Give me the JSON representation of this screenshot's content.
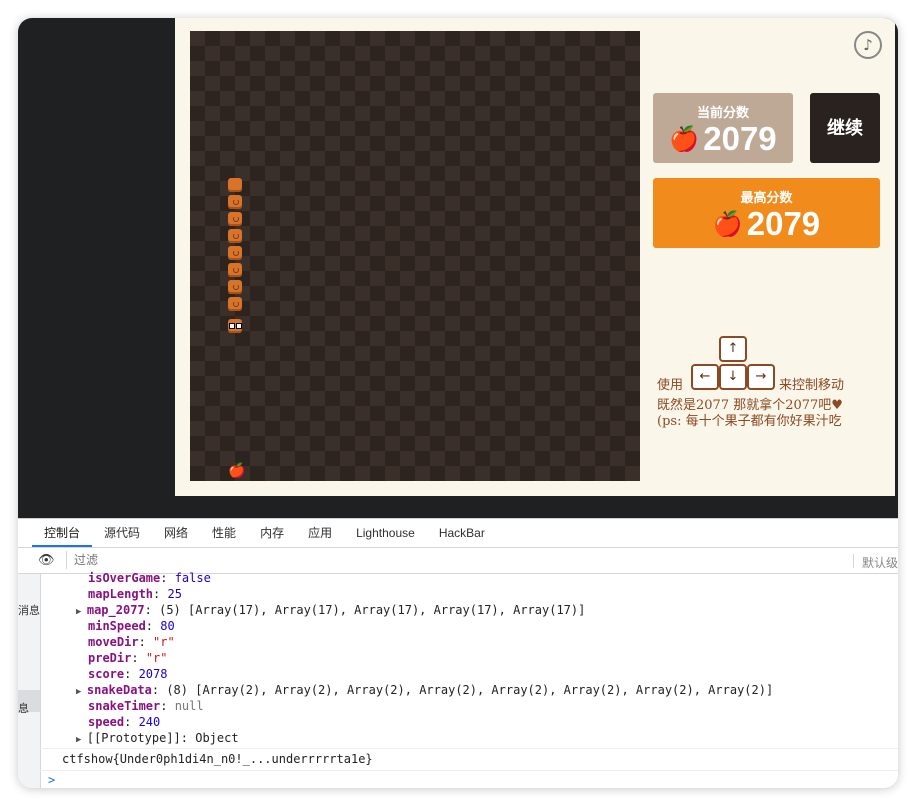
{
  "game": {
    "current_score_label": "当前分数",
    "current_score": "2079",
    "continue_label": "继续",
    "best_score_label": "最高分数",
    "best_score": "2079",
    "music_icon": "♪",
    "apple_icon": "🍎",
    "help_use": "使用",
    "help_control": "来控制移动",
    "help_line2": "既然是2077 那就拿个2077吧♥",
    "help_line3": "(ps: 每十个果子都有你好果汁吃",
    "keys": [
      "↑",
      "←",
      "↓",
      "→"
    ]
  },
  "devtools": {
    "tabs": [
      "控制台",
      "源代码",
      "网络",
      "性能",
      "内存",
      "应用",
      "Lighthouse",
      "HackBar"
    ],
    "filter_placeholder": "过滤",
    "levels_label": "默认级",
    "sidebar_labels": [
      "消息",
      "息"
    ],
    "console_lines": [
      {
        "key": "isOverGame",
        "value": "false",
        "vclass": "n"
      },
      {
        "key": "mapLength",
        "value": "25",
        "vclass": "n"
      },
      {
        "key": "map_2077",
        "expand": true,
        "value": "(5) [Array(17), Array(17), Array(17), Array(17), Array(17)]",
        "vclass": ""
      },
      {
        "key": "minSpeed",
        "value": "80",
        "vclass": "n"
      },
      {
        "key": "moveDir",
        "value": "\"r\"",
        "vclass": "s"
      },
      {
        "key": "preDir",
        "value": "\"r\"",
        "vclass": "s"
      },
      {
        "key": "score",
        "value": "2078",
        "vclass": "n"
      },
      {
        "key": "snakeData",
        "expand": true,
        "value": "(8) [Array(2), Array(2), Array(2), Array(2), Array(2), Array(2), Array(2), Array(2)]",
        "vclass": ""
      },
      {
        "key": "snakeTimer",
        "value": "null",
        "vclass": "g"
      },
      {
        "key": "speed",
        "value": "240",
        "vclass": "n"
      },
      {
        "key": "[[Prototype]]",
        "expand": true,
        "value": "Object",
        "vclass": "",
        "plainkey": true
      }
    ],
    "flag_output": "ctfshow{Under0ph1di4n_n0!_...underrrrrta1e}",
    "prompt": ">"
  }
}
